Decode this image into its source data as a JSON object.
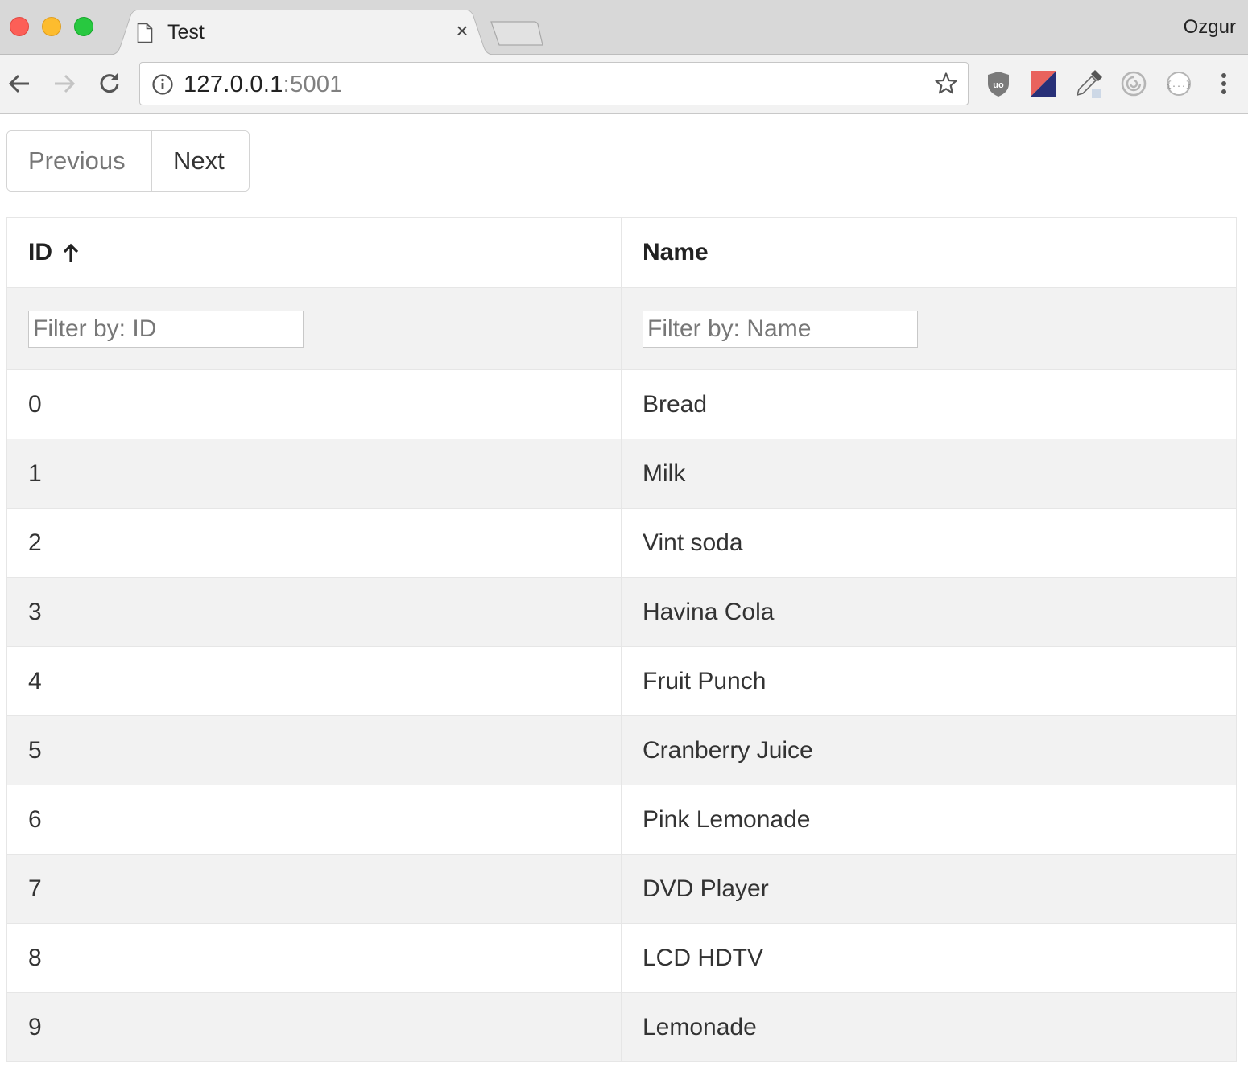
{
  "browser": {
    "tab_title": "Test",
    "profile_name": "Ozgur",
    "url_host": "127.0.0.1",
    "url_port": ":5001",
    "icons": [
      "back-arrow-icon",
      "forward-arrow-icon",
      "reload-icon",
      "info-icon",
      "star-icon",
      "ublock-icon",
      "flag-extension-icon",
      "eyedropper-icon",
      "spiral-extension-icon",
      "json-viewer-icon",
      "more-menu-icon"
    ]
  },
  "pagination": {
    "previous_label": "Previous",
    "next_label": "Next"
  },
  "table": {
    "columns": [
      {
        "label": "ID",
        "sort": "ascending",
        "filter_placeholder": "Filter by: ID"
      },
      {
        "label": "Name",
        "filter_placeholder": "Filter by: Name"
      }
    ],
    "rows": [
      {
        "id": "0",
        "name": "Bread"
      },
      {
        "id": "1",
        "name": "Milk"
      },
      {
        "id": "2",
        "name": "Vint soda"
      },
      {
        "id": "3",
        "name": "Havina Cola"
      },
      {
        "id": "4",
        "name": "Fruit Punch"
      },
      {
        "id": "5",
        "name": "Cranberry Juice"
      },
      {
        "id": "6",
        "name": "Pink Lemonade"
      },
      {
        "id": "7",
        "name": "DVD Player"
      },
      {
        "id": "8",
        "name": "LCD HDTV"
      },
      {
        "id": "9",
        "name": "Lemonade"
      }
    ]
  },
  "colors": {
    "stripe": "#f2f2f2",
    "border": "#e6e6e6",
    "chrome_bg": "#d8d8d8",
    "toolbar_bg": "#f2f2f2"
  }
}
